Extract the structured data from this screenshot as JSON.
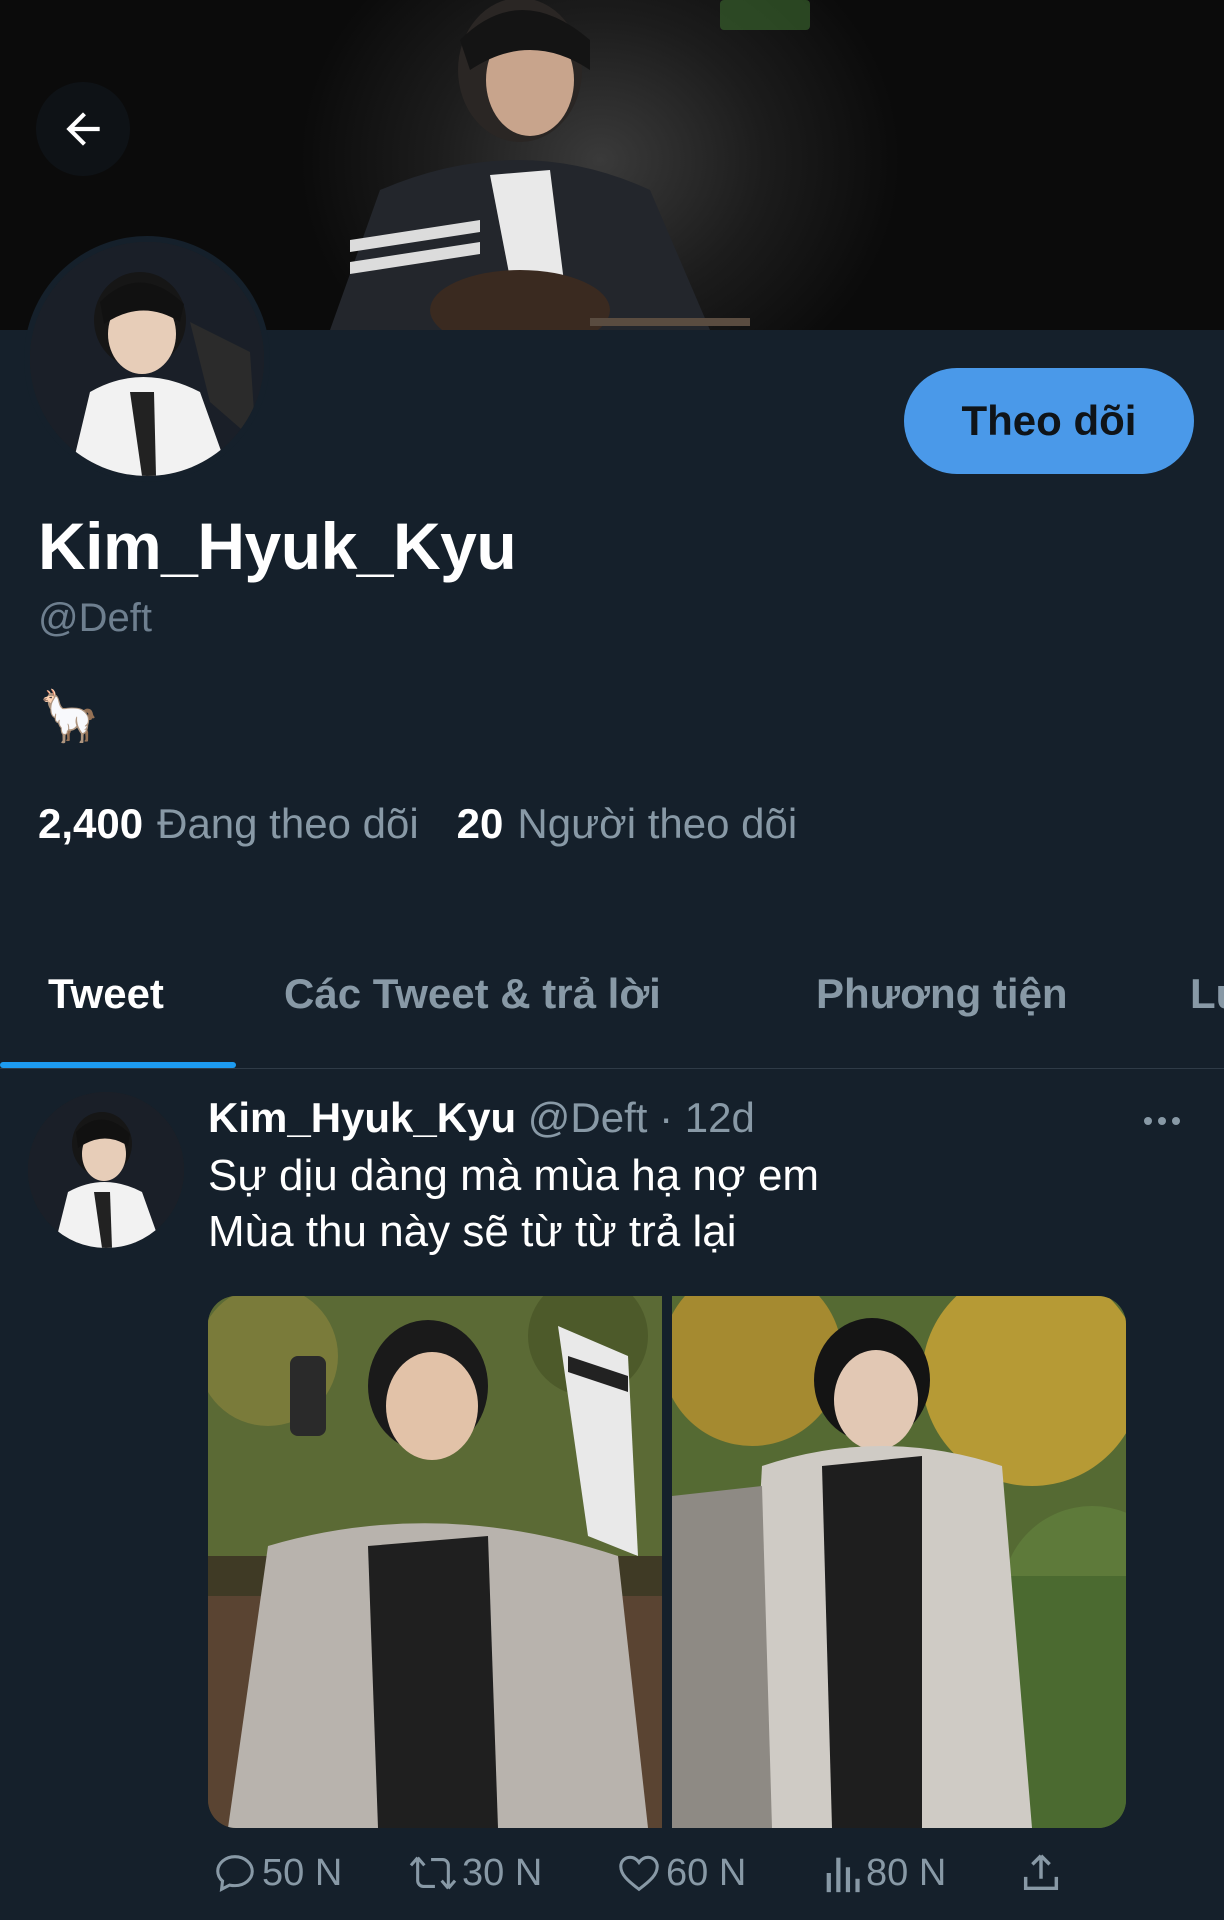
{
  "profile": {
    "display_name": "Kim_Hyuk_Kyu",
    "handle": "@Deft",
    "bio": "🦙",
    "follow_label": "Theo dõi",
    "following_count": "2,400",
    "following_label": "Đang theo dõi",
    "followers_count": "20",
    "followers_label": "Người theo dõi"
  },
  "tabs": [
    {
      "label": "Tweet",
      "active": true
    },
    {
      "label": "Các Tweet & trả lời",
      "active": false
    },
    {
      "label": "Phương tiện",
      "active": false
    },
    {
      "label": "Lư",
      "active": false
    }
  ],
  "tweet": {
    "author_name": "Kim_Hyuk_Kyu",
    "author_handle": "@Deft",
    "separator": " · ",
    "time": "12d",
    "lines": [
      "Sự dịu dàng mà mùa hạ nợ em",
      "Mùa thu này sẽ từ từ trả lại"
    ],
    "stats": {
      "replies": "50 N",
      "retweets": "30 N",
      "likes": "60 N",
      "views": "80 N"
    }
  },
  "icons": {
    "back": "arrow-left-icon",
    "more": "more-horizontal-icon",
    "reply": "reply-icon",
    "retweet": "retweet-icon",
    "like": "heart-icon",
    "views": "views-chart-icon",
    "share": "share-icon"
  },
  "colors": {
    "background": "#15202b",
    "accent": "#1d9bf0",
    "follow_button": "#4a99e9",
    "muted_text": "#8899a6"
  }
}
